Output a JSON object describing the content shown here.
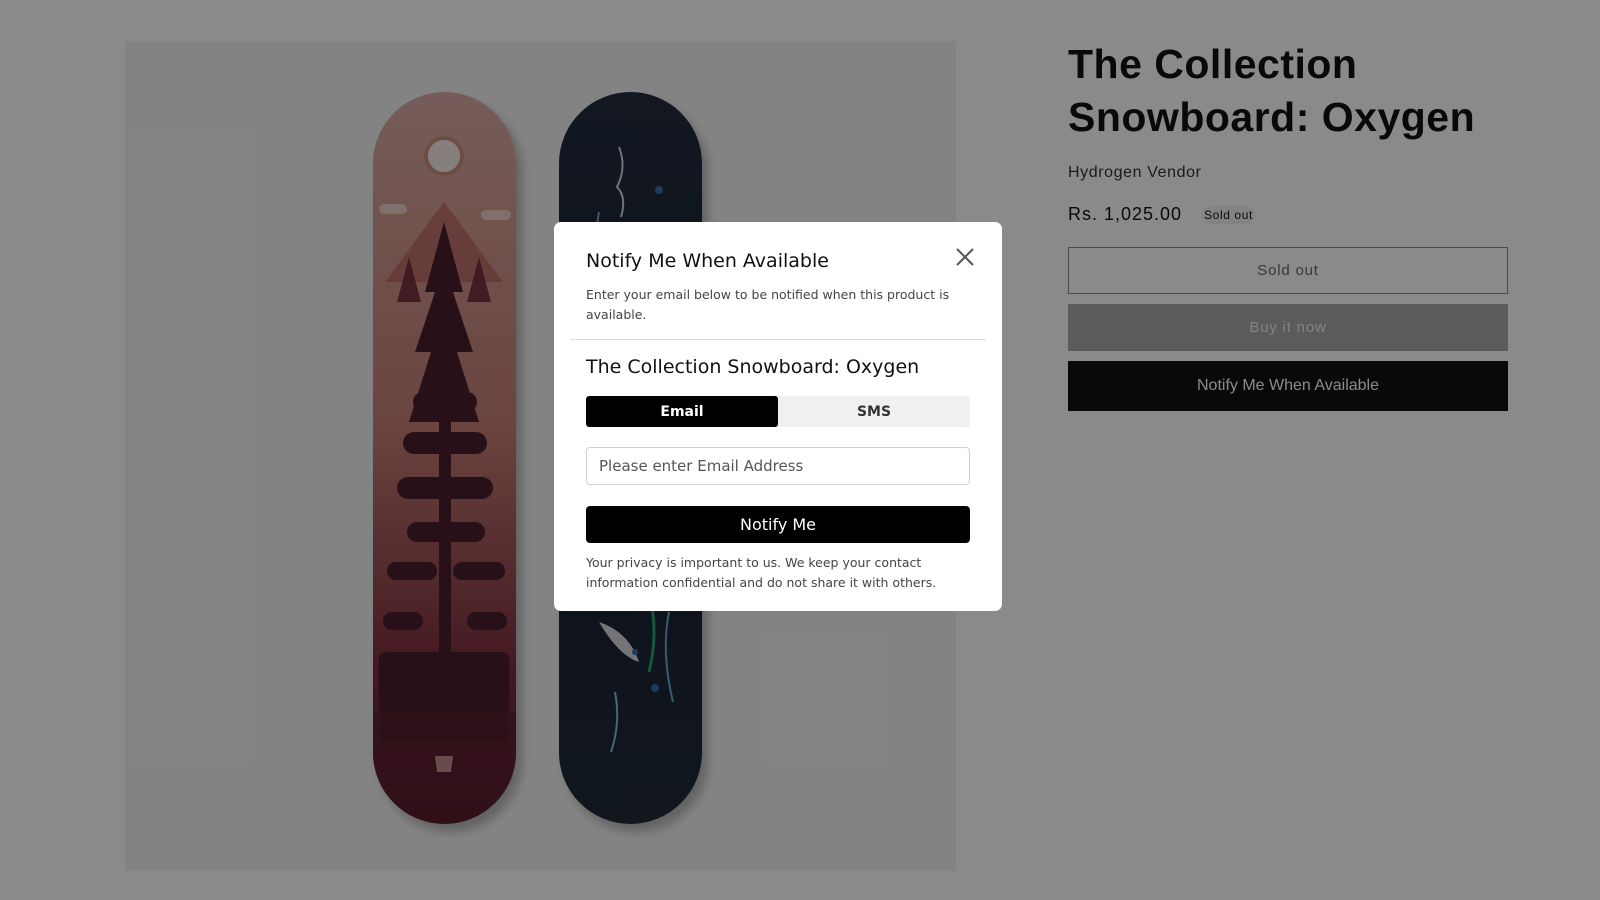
{
  "product": {
    "title": "The Collection Snowboard: Oxygen",
    "vendor": "Hydrogen Vendor",
    "price": "Rs. 1,025.00",
    "badge": "Sold out",
    "buttons": {
      "sold_out": "Sold out",
      "buy_now": "Buy it now",
      "notify": "Notify Me When Available"
    }
  },
  "modal": {
    "title": "Notify Me When Available",
    "description": "Enter your email below to be notified when this product is available.",
    "product_name": "The Collection Snowboard: Oxygen",
    "tabs": [
      {
        "label": "Email",
        "active": true
      },
      {
        "label": "SMS",
        "active": false
      }
    ],
    "email_placeholder": "Please enter Email Address",
    "submit_label": "Notify Me",
    "privacy": "Your privacy is important to us. We keep your contact information confidential and do not share it with others."
  },
  "colors": {
    "overlay": "rgba(0,0,0,0.46)",
    "accent": "#000000",
    "board_red_top": "#d6a8a0",
    "board_red_bottom": "#5a1f2e",
    "board_navy": "#1b2433"
  },
  "icons": {
    "close": "close-icon",
    "shopify_logo": "shopify-bag-icon"
  }
}
